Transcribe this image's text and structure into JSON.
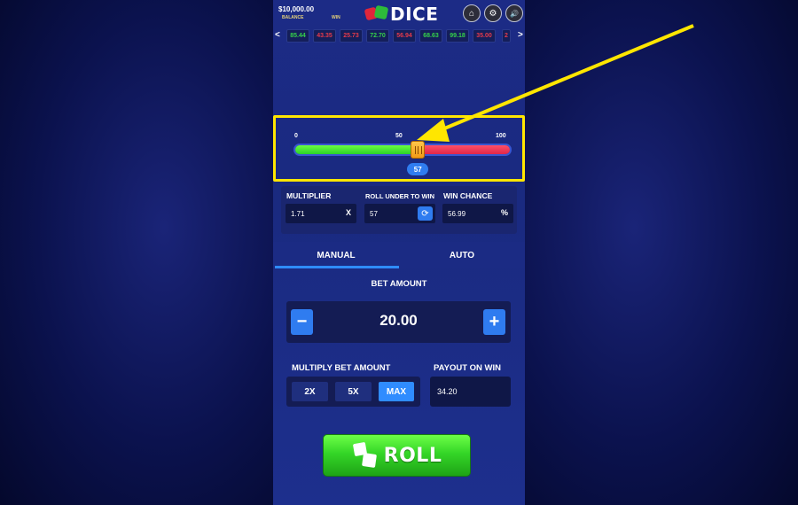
{
  "header": {
    "balance": "$10,000.00",
    "balance_label": "BALANCE",
    "win_label": "WIN",
    "logo_text": "DICE",
    "buttons": [
      {
        "name": "home-button",
        "icon": "home-icon",
        "glyph": "⌂"
      },
      {
        "name": "settings-button",
        "icon": "gear-icon",
        "glyph": "⚙"
      },
      {
        "name": "sound-button",
        "icon": "speaker-icon",
        "glyph": "🔊"
      }
    ]
  },
  "history": {
    "prev_glyph": "<",
    "next_glyph": ">",
    "items": [
      {
        "value": "85.44",
        "color": "green"
      },
      {
        "value": "43.35",
        "color": "red"
      },
      {
        "value": "25.73",
        "color": "red"
      },
      {
        "value": "72.70",
        "color": "green"
      },
      {
        "value": "56.94",
        "color": "red"
      },
      {
        "value": "68.63",
        "color": "green"
      },
      {
        "value": "99.18",
        "color": "green"
      },
      {
        "value": "35.00",
        "color": "red"
      },
      {
        "value": "2",
        "color": "red"
      }
    ]
  },
  "slider": {
    "min_label": "0",
    "mid_label": "50",
    "max_label": "100",
    "value": 57,
    "value_label": "57"
  },
  "stats": {
    "multiplier_label": "MULTIPLIER",
    "multiplier_value": "1.71",
    "multiplier_suffix": "X",
    "roll_under_label": "ROLL UNDER TO WIN",
    "roll_under_value": "57",
    "win_chance_label": "WIN CHANCE",
    "win_chance_value": "56.99",
    "win_chance_suffix": "%"
  },
  "tabs": [
    {
      "label": "MANUAL",
      "active": true
    },
    {
      "label": "AUTO",
      "active": false
    }
  ],
  "bet": {
    "title": "BET AMOUNT",
    "value": "20.00",
    "minus": "−",
    "plus": "+"
  },
  "multiply": {
    "title": "MULTIPLY BET AMOUNT",
    "options": [
      "2X",
      "5X",
      "MAX"
    ],
    "active": "MAX"
  },
  "payout": {
    "title": "PAYOUT ON WIN",
    "value": "34.20"
  },
  "roll": {
    "label": "ROLL"
  },
  "colors": {
    "highlight": "#ffe600",
    "accent": "#2f7cf0",
    "win_green": "#35d24a",
    "lose_red": "#e63a4a"
  }
}
